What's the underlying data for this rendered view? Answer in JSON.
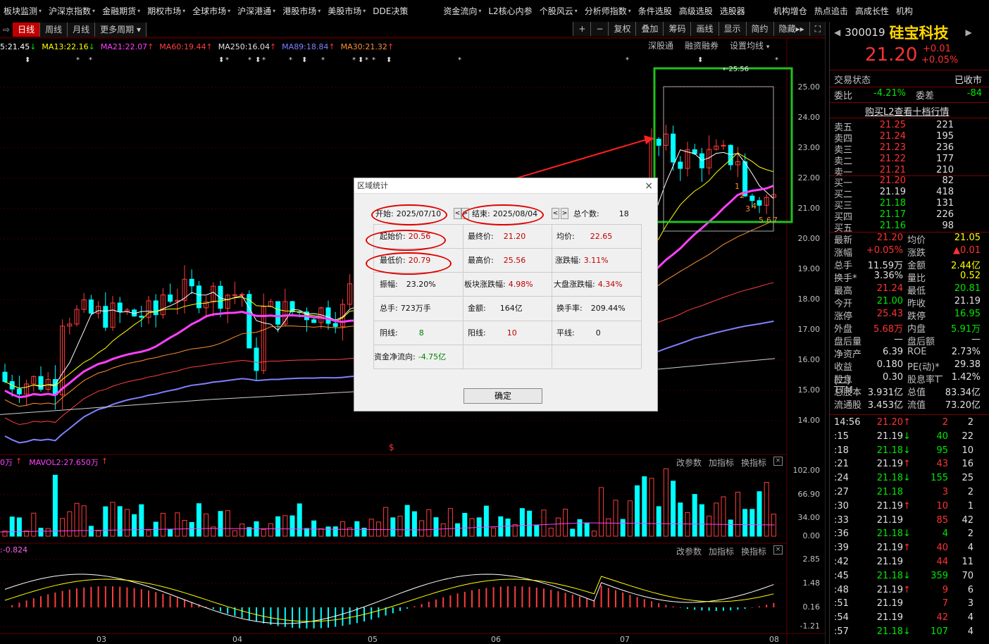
{
  "menubar": [
    "板块监测",
    "沪深京指数",
    "金融期货",
    "期权市场",
    "全球市场",
    "沪深港通",
    "港股市场",
    "美股市场",
    "DDE决策",
    "资金流向",
    "L2核心内参",
    "个股风云",
    "分析师指数",
    "条件选股",
    "高级选股",
    "选股器",
    "机构增仓",
    "热点追击",
    "高成长性",
    "机构"
  ],
  "menu_carets": [
    true,
    true,
    true,
    true,
    true,
    true,
    true,
    true,
    false,
    true,
    false,
    true,
    true,
    false,
    false,
    false,
    false,
    false,
    false,
    false
  ],
  "toolbar": {
    "left_glyph": "⇨",
    "periods": [
      "日线",
      "周线",
      "月线",
      "更多周期"
    ],
    "more_caret": "▾",
    "right_items": [
      "+",
      "−",
      "复权",
      "叠加",
      "筹码",
      "画线",
      "显示",
      "简约",
      "隐藏"
    ],
    "hide_suffix": "▸▸",
    "full_icon": "⛶"
  },
  "ma_legend": [
    {
      "text": "5:21.45",
      "color": "#ffffff",
      "arrow": "↓",
      "arrow_color": "#00e600"
    },
    {
      "text": "MA13:22.16",
      "color": "#ffff00",
      "arrow": "↓",
      "arrow_color": "#00e600"
    },
    {
      "text": "MA21:22.07",
      "color": "#ff40ff",
      "arrow": "↑",
      "arrow_color": "#ff3232"
    },
    {
      "text": "MA60:19.44",
      "color": "#ff4040",
      "arrow": "↑",
      "arrow_color": "#ff3232"
    },
    {
      "text": "MA250:16.04",
      "color": "#e0e0e0",
      "arrow": "↑",
      "arrow_color": "#ff3232"
    },
    {
      "text": "MA89:18.84",
      "color": "#8080ff",
      "arrow": "↑",
      "arrow_color": "#ff3232"
    },
    {
      "text": "MA30:21.32",
      "color": "#ff9030",
      "arrow": "↑",
      "arrow_color": "#ff3232"
    }
  ],
  "chart_links": [
    "深股通",
    "融资融券",
    "设置均线"
  ],
  "chart_links_caret": "▾",
  "price_ticks": [
    "25.00",
    "24.00",
    "23.00",
    "22.00",
    "21.00",
    "20.00",
    "19.00",
    "18.00",
    "17.00",
    "16.00",
    "15.00",
    "14.00"
  ],
  "high_marker": "←25.56",
  "highlight_numbers": [
    "1",
    "2",
    "3",
    "4",
    "5",
    "6",
    "7"
  ],
  "volume": {
    "legend": "0万",
    "ma_label": "MAVOL2:27.650万",
    "arrow": "↑",
    "ticks": [
      "102.00",
      "66.90",
      "34.00",
      "0.00"
    ]
  },
  "macd": {
    "legend": ":-0.824",
    "ticks": [
      "2.85",
      "1.48",
      "0.16",
      "-1.21"
    ]
  },
  "panel_buttons": [
    "改参数",
    "加指标",
    "换指标"
  ],
  "close_glyph": "×",
  "date_ticks": [
    "03",
    "04",
    "05",
    "06",
    "07",
    "08"
  ],
  "s_marker": "$",
  "dialog": {
    "title": "区域统计",
    "close": "×",
    "start_label": "开始:",
    "start_value": "2025/07/10",
    "end_label": "结束:",
    "end_value": "2025/08/04",
    "nav_left": "<",
    "nav_right": ">",
    "count_label": "总个数:",
    "count_value": "18",
    "open_label": "起始价:",
    "open_value": "20.56",
    "close_label": "最终价:",
    "close_value": "21.20",
    "avg_label": "均价:",
    "avg_value": "22.65",
    "low_label": "最低价:",
    "low_value": "20.79",
    "high_label": "最高价:",
    "high_value": "25.56",
    "chg_label": "涨跌幅:",
    "chg_value": "3.11%",
    "amp_label": "振幅:",
    "amp_value": "23.20%",
    "sector_label": "板块涨跌幅:",
    "sector_value": "4.98%",
    "market_label": "大盘涨跌幅:",
    "market_value": "4.34%",
    "vol_label": "总手:",
    "vol_value": "723万手",
    "amt_label": "金额:",
    "amt_value": "164亿",
    "turn_label": "换手率:",
    "turn_value": "209.44%",
    "yin_label": "阴线:",
    "yin_value": "8",
    "yang_label": "阳线:",
    "yang_value": "10",
    "flat_label": "平线:",
    "flat_value": "0",
    "flow_label": "资金净流向:",
    "flow_value": "-4.75亿",
    "ok": "确定"
  },
  "quote": {
    "code": "300019",
    "name": "硅宝科技",
    "nav_prev": "◀",
    "nav_next": "▶",
    "price": "21.20",
    "change": "+0.01",
    "change_pct": "+0.05%",
    "status_label": "交易状态",
    "status_value": "已收市",
    "weibi_label": "委比",
    "weibi_value": "-4.21%",
    "weicha_label": "委差",
    "weicha_value": "-84",
    "l2_link": "购买L2查看十档行情",
    "asks": [
      {
        "label": "卖五",
        "price": "21.25",
        "vol": "221"
      },
      {
        "label": "卖四",
        "price": "21.24",
        "vol": "195"
      },
      {
        "label": "卖三",
        "price": "21.23",
        "vol": "236"
      },
      {
        "label": "卖二",
        "price": "21.22",
        "vol": "177"
      },
      {
        "label": "卖一",
        "price": "21.21",
        "vol": "210"
      }
    ],
    "bids": [
      {
        "label": "买一",
        "price": "21.20",
        "vol": "82"
      },
      {
        "label": "买二",
        "price": "21.19",
        "vol": "418"
      },
      {
        "label": "买三",
        "price": "21.18",
        "vol": "131"
      },
      {
        "label": "买四",
        "price": "21.17",
        "vol": "226"
      },
      {
        "label": "买五",
        "price": "21.16",
        "vol": "98"
      }
    ],
    "stats": [
      {
        "l1": "最新",
        "v1": "21.20",
        "c1": "red",
        "l2": "均价",
        "v2": "21.05",
        "c2": "yel"
      },
      {
        "l1": "涨幅",
        "v1": "+0.05%",
        "c1": "red",
        "l2": "涨跌",
        "v2": "▲0.01",
        "c2": "red"
      },
      {
        "l1": "总手",
        "v1": "11.59万",
        "c1": "wht",
        "l2": "金额",
        "v2": "2.44亿",
        "c2": "yel"
      },
      {
        "l1": "换手*",
        "v1": "3.36%",
        "c1": "wht",
        "l2": "量比",
        "v2": "0.52",
        "c2": "yel"
      },
      {
        "l1": "最高",
        "v1": "21.24",
        "c1": "red",
        "l2": "最低",
        "v2": "20.81",
        "c2": "grn"
      },
      {
        "l1": "今开",
        "v1": "21.00",
        "c1": "grn",
        "l2": "昨收",
        "v2": "21.19",
        "c2": "wht"
      },
      {
        "l1": "涨停",
        "v1": "25.43",
        "c1": "red",
        "l2": "跌停",
        "v2": "16.95",
        "c2": "grn"
      },
      {
        "l1": "外盘",
        "v1": "5.68万",
        "c1": "red",
        "l2": "内盘",
        "v2": "5.91万",
        "c2": "grn"
      },
      {
        "l1": "盘后量",
        "v1": "—",
        "c1": "wht",
        "l2": "盘后额",
        "v2": "—",
        "c2": "wht"
      },
      {
        "l1": "净资产",
        "v1": "6.39",
        "c1": "wht",
        "l2": "ROE",
        "v2": "2.73%",
        "c2": "wht"
      },
      {
        "l1": "收益(二)",
        "v1": "0.180",
        "c1": "wht",
        "l2": "PE(动)*",
        "v2": "29.38",
        "c2": "wht"
      },
      {
        "l1": "股息TTM",
        "v1": "0.30",
        "c1": "wht",
        "l2": "股息率TTM",
        "v2": "1.42%",
        "c2": "wht"
      },
      {
        "l1": "总股本",
        "v1": "3.931亿",
        "c1": "wht",
        "l2": "总值",
        "v2": "83.34亿",
        "c2": "wht"
      },
      {
        "l1": "流通股",
        "v1": "3.453亿",
        "c1": "wht",
        "l2": "流值",
        "v2": "73.20亿",
        "c2": "wht"
      }
    ],
    "ticks": [
      {
        "t": "14:56",
        "p": "21.20",
        "pc": "red",
        "d": "↑",
        "v": "2",
        "n": "2"
      },
      {
        "t": ":15",
        "p": "21.19",
        "pc": "wht",
        "d": "↓",
        "v": "40",
        "n": "22"
      },
      {
        "t": ":18",
        "p": "21.18",
        "pc": "grn",
        "d": "↓",
        "v": "95",
        "n": "10"
      },
      {
        "t": ":21",
        "p": "21.19",
        "pc": "wht",
        "d": "↑",
        "v": "43",
        "n": "16"
      },
      {
        "t": ":24",
        "p": "21.18",
        "pc": "grn",
        "d": "↓",
        "v": "155",
        "n": "25"
      },
      {
        "t": ":27",
        "p": "21.18",
        "pc": "grn",
        "d": "",
        "v": "3",
        "n": "2"
      },
      {
        "t": ":30",
        "p": "21.19",
        "pc": "wht",
        "d": "↑",
        "v": "10",
        "n": "1"
      },
      {
        "t": ":33",
        "p": "21.19",
        "pc": "wht",
        "d": "",
        "v": "85",
        "n": "42"
      },
      {
        "t": ":36",
        "p": "21.18",
        "pc": "grn",
        "d": "↓",
        "v": "4",
        "n": "2"
      },
      {
        "t": ":39",
        "p": "21.19",
        "pc": "wht",
        "d": "↑",
        "v": "40",
        "n": "4"
      },
      {
        "t": ":42",
        "p": "21.19",
        "pc": "wht",
        "d": "",
        "v": "44",
        "n": "11"
      },
      {
        "t": ":45",
        "p": "21.18",
        "pc": "grn",
        "d": "↓",
        "v": "359",
        "n": "70"
      },
      {
        "t": ":48",
        "p": "21.19",
        "pc": "wht",
        "d": "↑",
        "v": "9",
        "n": "6"
      },
      {
        "t": ":51",
        "p": "21.19",
        "pc": "wht",
        "d": "",
        "v": "7",
        "n": "3"
      },
      {
        "t": ":54",
        "p": "21.19",
        "pc": "wht",
        "d": "",
        "v": "42",
        "n": "4"
      },
      {
        "t": ":57",
        "p": "21.18",
        "pc": "grn",
        "d": "↓",
        "v": "107",
        "n": "4"
      }
    ]
  }
}
